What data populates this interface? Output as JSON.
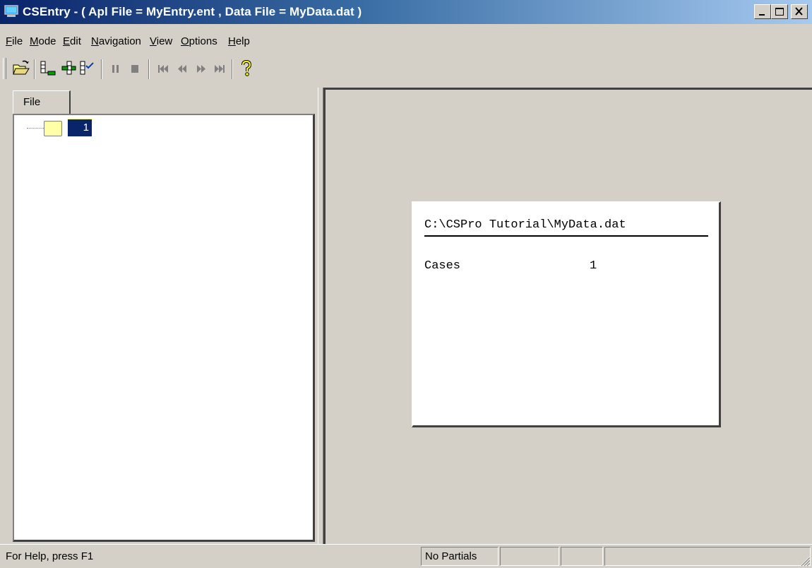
{
  "window": {
    "title": "CSEntry - ( Apl File = MyEntry.ent , Data File = MyData.dat )"
  },
  "menu": {
    "items": [
      {
        "accel": "F",
        "rest": "ile"
      },
      {
        "accel": "M",
        "rest": "ode"
      },
      {
        "accel": "E",
        "rest": "dit"
      },
      {
        "accel": "N",
        "rest": "avigation"
      },
      {
        "accel": "V",
        "rest": "iew"
      },
      {
        "accel": "O",
        "rest": "ptions"
      },
      {
        "accel": "H",
        "rest": "elp"
      }
    ]
  },
  "toolbar": {
    "icons": [
      "open-folder-icon",
      "add-case-icon",
      "insert-case-icon",
      "verify-case-icon",
      "pause-icon",
      "stop-icon",
      "first-case-icon",
      "previous-case-icon",
      "next-case-icon",
      "last-case-icon",
      "help-icon"
    ]
  },
  "left_pane": {
    "tab_label": "File",
    "tree": {
      "node_label": "1"
    }
  },
  "info_box": {
    "path": "C:\\CSPro Tutorial\\MyData.dat",
    "cases_label": "Cases",
    "cases_value": "1"
  },
  "statusbar": {
    "help_text": "For Help, press F1",
    "partials": "No Partials"
  },
  "colors": {
    "title_start": "#0a246a",
    "title_end": "#a6caf0",
    "face": "#d4d0c8",
    "selection": "#0a246a",
    "node_fill": "#ffffa8"
  }
}
